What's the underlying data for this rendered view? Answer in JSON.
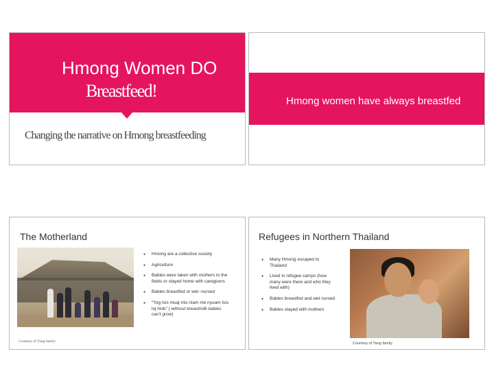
{
  "colors": {
    "accent": "#e5145f",
    "slide_border": "#b9b9b9"
  },
  "slide1": {
    "title_line1": "Hmong Women DO",
    "title_line2": "Breastfeed!",
    "subtitle": "Changing the narrative on Hmong breastfeeding"
  },
  "slide2": {
    "text": "Hmong women have always breastfed"
  },
  "slide3": {
    "title": "The Motherland",
    "bullets": [
      "Hmong are a collective society",
      "Agriculture",
      "Babies were taken with mothers to the fields or stayed home with caregivers",
      "Babies breastfed or wet  -nursed"
    ],
    "quote_bullet": "“Yog tsis muaj mis niam me nyuam tsis loj hlob” (",
    "quote_translation": "without breastmilk babies can't grow",
    "quote_close": ")",
    "credit": "Courtesy of Yang family",
    "photo_icon": "family-photo"
  },
  "slide4": {
    "title": "Refugees in Northern Thailand",
    "bullets": [
      "Many Hmong escaped to Thailand",
      "Lived in refugee camps (how many were there and who they lived with)",
      "Babies breastfed and wet nursed",
      "Babies stayed with mothers"
    ],
    "credit": "Courtesy of Yang family",
    "photo_icon": "mother-and-child-photo"
  }
}
